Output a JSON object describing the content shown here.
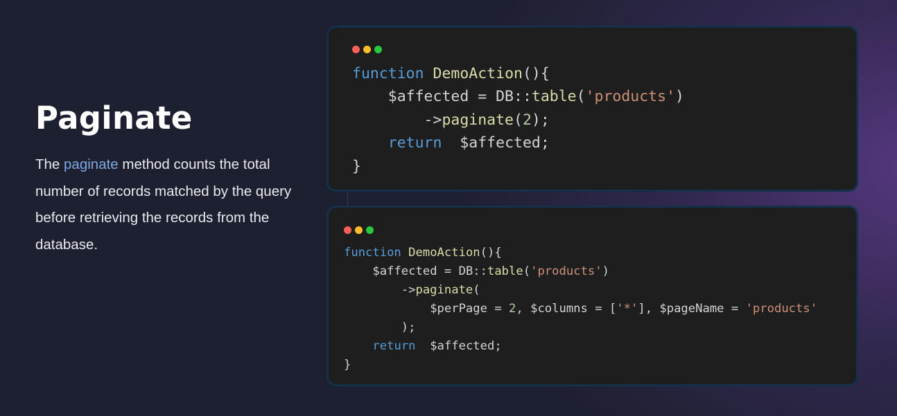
{
  "section": {
    "title": "Paginate",
    "description_before": "The ",
    "description_highlight": "paginate",
    "description_after": " method counts the total number of records matched by the query before retrieving the records from the database."
  },
  "colors": {
    "background": "#1d2030",
    "accent_purple": "#5e3c8c",
    "highlight": "#7fa8e0",
    "card_bg": "#1e1e1e",
    "card_border": "#14304a",
    "dot_red": "#ff5f56",
    "dot_yellow": "#ffbd2e",
    "dot_green": "#27c93f"
  },
  "code_block_1": {
    "lines": [
      [
        {
          "t": "kw",
          "v": "function"
        },
        {
          "t": "plain",
          "v": " "
        },
        {
          "t": "fn",
          "v": "DemoAction"
        },
        {
          "t": "plain",
          "v": "(){"
        }
      ],
      [
        {
          "t": "plain",
          "v": "    "
        },
        {
          "t": "var",
          "v": "$affected"
        },
        {
          "t": "plain",
          "v": " = DB::"
        },
        {
          "t": "fn",
          "v": "table"
        },
        {
          "t": "plain",
          "v": "("
        },
        {
          "t": "str",
          "v": "'products'"
        },
        {
          "t": "plain",
          "v": ")"
        }
      ],
      [
        {
          "t": "plain",
          "v": "        ->"
        },
        {
          "t": "fn",
          "v": "paginate"
        },
        {
          "t": "plain",
          "v": "("
        },
        {
          "t": "num",
          "v": "2"
        },
        {
          "t": "plain",
          "v": ");"
        }
      ],
      [
        {
          "t": "plain",
          "v": "    "
        },
        {
          "t": "kw",
          "v": "return"
        },
        {
          "t": "plain",
          "v": "  "
        },
        {
          "t": "var",
          "v": "$affected"
        },
        {
          "t": "plain",
          "v": ";"
        }
      ],
      [
        {
          "t": "plain",
          "v": "}"
        }
      ]
    ]
  },
  "code_block_2": {
    "lines": [
      [
        {
          "t": "kw",
          "v": "function"
        },
        {
          "t": "plain",
          "v": " "
        },
        {
          "t": "fn",
          "v": "DemoAction"
        },
        {
          "t": "plain",
          "v": "(){"
        }
      ],
      [
        {
          "t": "plain",
          "v": "    "
        },
        {
          "t": "var",
          "v": "$affected"
        },
        {
          "t": "plain",
          "v": " = DB::"
        },
        {
          "t": "fn",
          "v": "table"
        },
        {
          "t": "plain",
          "v": "("
        },
        {
          "t": "str",
          "v": "'products'"
        },
        {
          "t": "plain",
          "v": ")"
        }
      ],
      [
        {
          "t": "plain",
          "v": "        ->"
        },
        {
          "t": "fn",
          "v": "paginate"
        },
        {
          "t": "plain",
          "v": "("
        }
      ],
      [
        {
          "t": "plain",
          "v": "            "
        },
        {
          "t": "var",
          "v": "$perPage"
        },
        {
          "t": "plain",
          "v": " = "
        },
        {
          "t": "num",
          "v": "2"
        },
        {
          "t": "plain",
          "v": ", "
        },
        {
          "t": "var",
          "v": "$columns"
        },
        {
          "t": "plain",
          "v": " = ["
        },
        {
          "t": "str",
          "v": "'*'"
        },
        {
          "t": "plain",
          "v": "], "
        },
        {
          "t": "var",
          "v": "$pageName"
        },
        {
          "t": "plain",
          "v": " = "
        },
        {
          "t": "str",
          "v": "'products'"
        }
      ],
      [
        {
          "t": "plain",
          "v": "        );"
        }
      ],
      [
        {
          "t": "plain",
          "v": "    "
        },
        {
          "t": "kw",
          "v": "return"
        },
        {
          "t": "plain",
          "v": "  "
        },
        {
          "t": "var",
          "v": "$affected"
        },
        {
          "t": "plain",
          "v": ";"
        }
      ],
      [
        {
          "t": "plain",
          "v": "}"
        }
      ]
    ]
  }
}
